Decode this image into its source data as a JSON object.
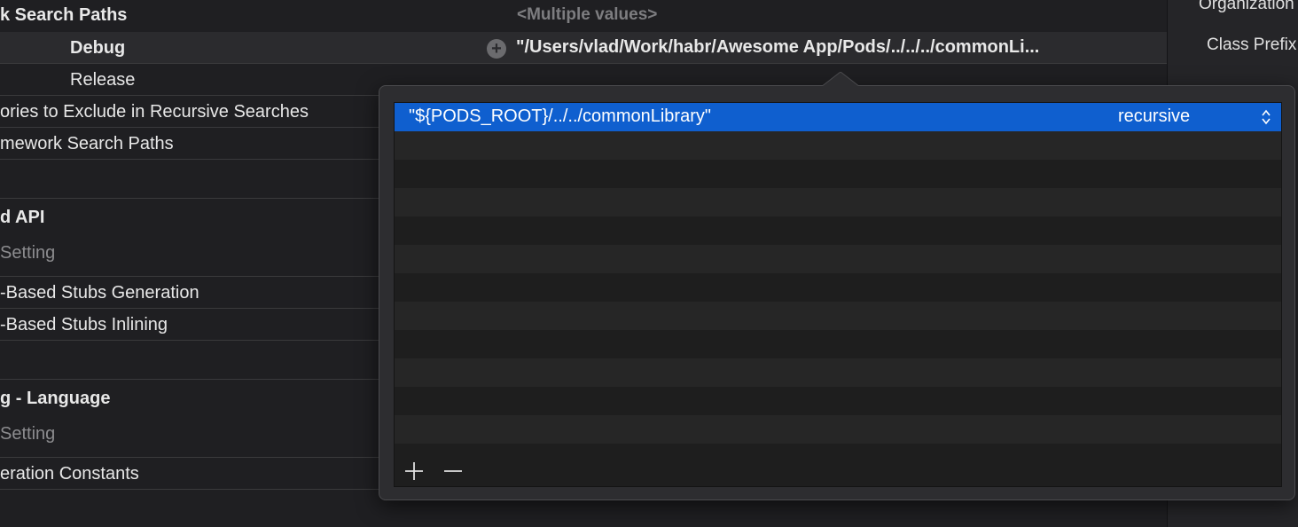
{
  "settings": {
    "rows": [
      {
        "label": "k Search Paths",
        "value": "<Multiple values>"
      },
      {
        "label": "Debug",
        "value": "\"/Users/vlad/Work/habr/Awesome App/Pods/../../../commonLi..."
      },
      {
        "label": "Release"
      },
      {
        "label": "ories to Exclude in Recursive Searches"
      },
      {
        "label": "mework Search Paths"
      },
      {
        "label": "d API"
      },
      {
        "label": "Setting"
      },
      {
        "label": "-Based Stubs Generation"
      },
      {
        "label": "-Based Stubs Inlining"
      },
      {
        "label": "g - Language"
      },
      {
        "label": "Setting"
      },
      {
        "label": "eration Constants"
      }
    ]
  },
  "inspector": {
    "organization_label": "Organization",
    "class_prefix_label": "Class Prefix"
  },
  "popover": {
    "entries": [
      {
        "path": "\"${PODS_ROOT}/../../commonLibrary\"",
        "mode": "recursive"
      }
    ],
    "add_icon": "plus-icon",
    "remove_icon": "minus-icon"
  },
  "colors": {
    "selection": "#0f5fcf",
    "background": "#1f1f22",
    "popover": "#2d2d30"
  }
}
